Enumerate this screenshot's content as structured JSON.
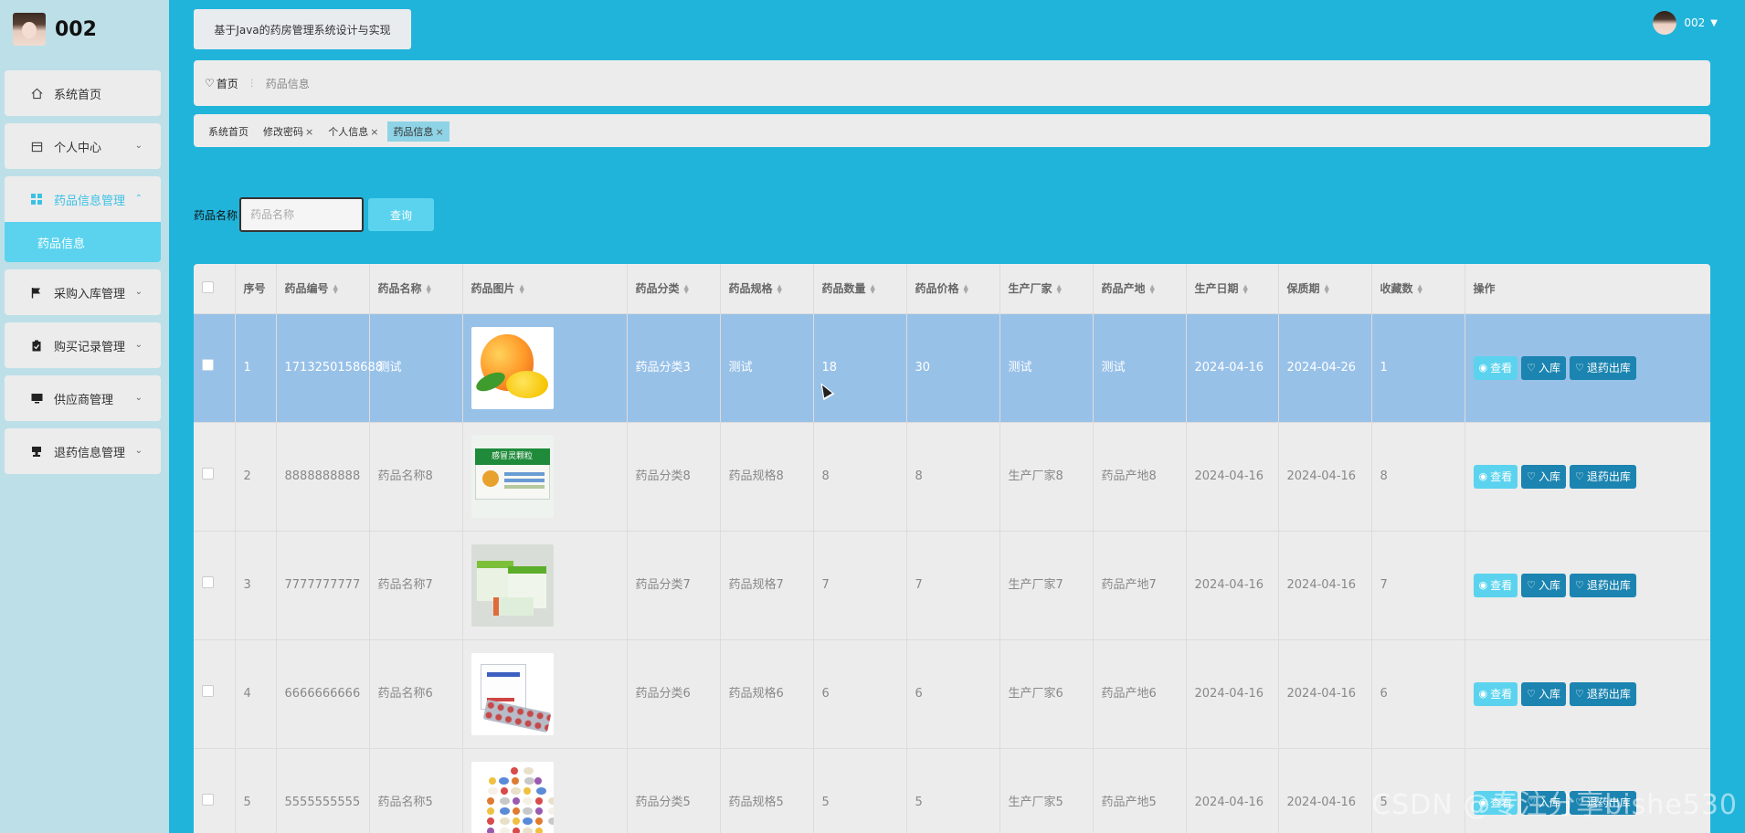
{
  "brand": {
    "name": "002"
  },
  "sidebar": {
    "items": [
      {
        "label": "系统首页",
        "icon": "home-icon",
        "has_children": false
      },
      {
        "label": "个人中心",
        "icon": "calendar-icon",
        "has_children": true
      },
      {
        "label": "药品信息管理",
        "icon": "grid-icon",
        "has_children": true,
        "active": true,
        "children": [
          {
            "label": "药品信息"
          }
        ]
      },
      {
        "label": "采购入库管理",
        "icon": "flag-icon",
        "has_children": true
      },
      {
        "label": "购买记录管理",
        "icon": "clipboard-icon",
        "has_children": true
      },
      {
        "label": "供应商管理",
        "icon": "monitor-icon",
        "has_children": true
      },
      {
        "label": "退药信息管理",
        "icon": "stamp-icon",
        "has_children": true
      }
    ]
  },
  "header": {
    "system_title": "基于Java的药房管理系统设计与实现",
    "user_name": "002"
  },
  "breadcrumb": {
    "home": "首页",
    "current": "药品信息"
  },
  "tabs": [
    {
      "label": "系统首页",
      "closable": false
    },
    {
      "label": "修改密码",
      "closable": true
    },
    {
      "label": "个人信息",
      "closable": true
    },
    {
      "label": "药品信息",
      "closable": true,
      "active": true
    }
  ],
  "search": {
    "label": "药品名称",
    "placeholder": "药品名称",
    "button": "查询"
  },
  "table": {
    "columns": [
      "序号",
      "药品编号",
      "药品名称",
      "药品图片",
      "药品分类",
      "药品规格",
      "药品数量",
      "药品价格",
      "生产厂家",
      "药品产地",
      "生产日期",
      "保质期",
      "收藏数",
      "操作"
    ],
    "sortable_columns": [
      "药品编号",
      "药品名称",
      "药品图片",
      "药品分类",
      "药品规格",
      "药品数量",
      "药品价格",
      "生产厂家",
      "药品产地",
      "生产日期",
      "保质期",
      "收藏数"
    ],
    "actions": {
      "view": "查看",
      "in": "入库",
      "out": "退药出库"
    },
    "rows": [
      {
        "no": "1",
        "code": "1713250158688",
        "name": "测试",
        "image": "mango",
        "category": "药品分类3",
        "spec": "测试",
        "qty": "18",
        "price": "30",
        "maker": "测试",
        "origin": "测试",
        "date": "2024-04-16",
        "expiry": "2024-04-26",
        "fav": "1",
        "selected": true
      },
      {
        "no": "2",
        "code": "8888888888",
        "name": "药品名称8",
        "image": "box8",
        "category": "药品分类8",
        "spec": "药品规格8",
        "qty": "8",
        "price": "8",
        "maker": "生产厂家8",
        "origin": "药品产地8",
        "date": "2024-04-16",
        "expiry": "2024-04-16",
        "fav": "8"
      },
      {
        "no": "3",
        "code": "7777777777",
        "name": "药品名称7",
        "image": "box7",
        "category": "药品分类7",
        "spec": "药品规格7",
        "qty": "7",
        "price": "7",
        "maker": "生产厂家7",
        "origin": "药品产地7",
        "date": "2024-04-16",
        "expiry": "2024-04-16",
        "fav": "7"
      },
      {
        "no": "4",
        "code": "6666666666",
        "name": "药品名称6",
        "image": "box6",
        "category": "药品分类6",
        "spec": "药品规格6",
        "qty": "6",
        "price": "6",
        "maker": "生产厂家6",
        "origin": "药品产地6",
        "date": "2024-04-16",
        "expiry": "2024-04-16",
        "fav": "6"
      },
      {
        "no": "5",
        "code": "5555555555",
        "name": "药品名称5",
        "image": "pills",
        "category": "药品分类5",
        "spec": "药品规格5",
        "qty": "5",
        "price": "5",
        "maker": "生产厂家5",
        "origin": "药品产地5",
        "date": "2024-04-16",
        "expiry": "2024-04-16",
        "fav": "5"
      }
    ]
  },
  "watermark": "CSDN @专注分享bishe530",
  "colors": {
    "accent": "#21b4da",
    "light_accent": "#5bd3ee",
    "dark_button": "#1b84b0",
    "selected_row": "#98c1e8"
  }
}
